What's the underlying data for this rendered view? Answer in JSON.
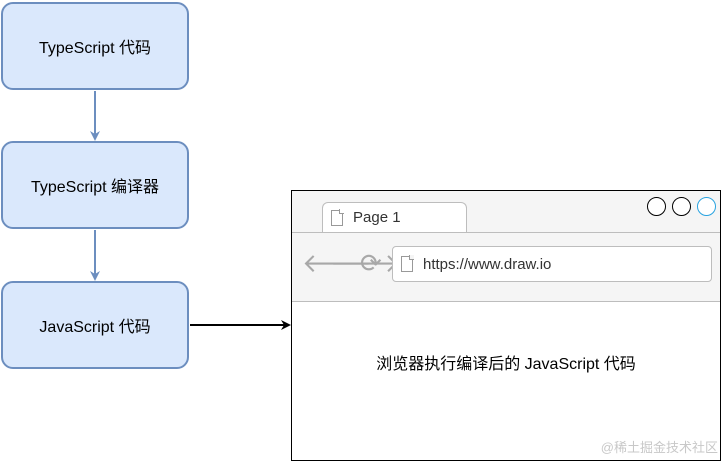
{
  "diagram": {
    "nodes": [
      {
        "id": "ts",
        "label": "TypeScript 代码"
      },
      {
        "id": "compiler",
        "label": "TypeScript 编译器"
      },
      {
        "id": "js",
        "label": "JavaScript 代码"
      }
    ],
    "edges": [
      {
        "from": "ts",
        "to": "compiler"
      },
      {
        "from": "compiler",
        "to": "js"
      },
      {
        "from": "js",
        "to": "browser"
      }
    ],
    "colors": {
      "node_fill": "#dae8fc",
      "node_stroke": "#6c8ebf",
      "arrow_blue": "#6c8ebf",
      "arrow_black": "#000000"
    }
  },
  "browser": {
    "tab_label": "Page 1",
    "tab_icon": "document-icon",
    "url": "https://www.draw.io",
    "url_icon": "document-icon",
    "nav_icons": [
      "back-arrow-icon",
      "forward-arrow-icon",
      "reload-icon"
    ],
    "window_controls": [
      "circle",
      "circle",
      "circle-blue"
    ],
    "body_text": "浏览器执行编译后的 JavaScript 代码"
  },
  "watermark": "@稀土掘金技术社区"
}
